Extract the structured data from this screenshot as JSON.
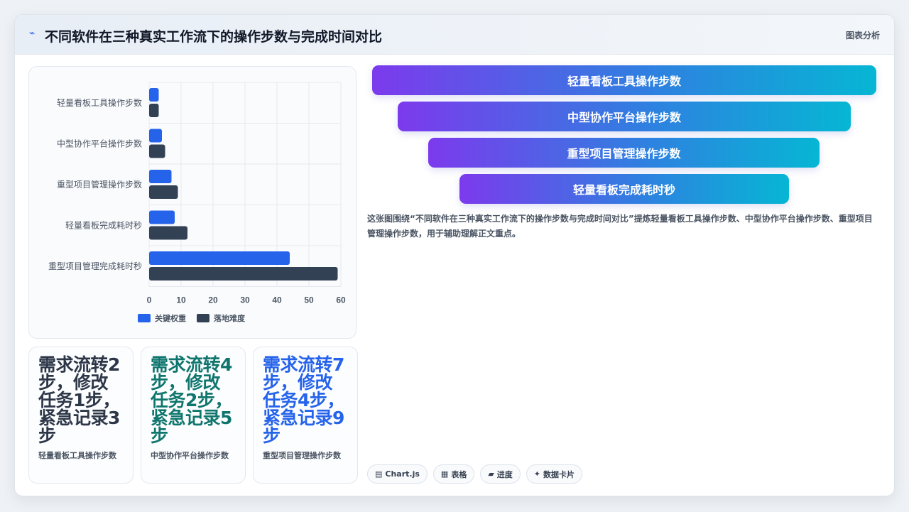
{
  "header": {
    "icon": "trend-line-icon",
    "title": "不同软件在三种真实工作流下的操作步数与完成时间对比",
    "right_label": "图表分析"
  },
  "chart_data": {
    "type": "bar",
    "orientation": "horizontal",
    "categories": [
      "轻量看板工具操作步数",
      "中型协作平台操作步数",
      "重型项目管理操作步数",
      "轻量看板完成耗时秒",
      "重型项目管理完成耗时秒"
    ],
    "series": [
      {
        "name": "关键权重",
        "values": [
          3,
          4,
          7,
          8,
          44
        ],
        "color": "#2563eb"
      },
      {
        "name": "落地难度",
        "values": [
          3,
          5,
          9,
          12,
          59
        ],
        "color": "#334155"
      }
    ],
    "xticks": [
      0,
      10,
      20,
      30,
      40,
      50,
      60
    ],
    "xlim": [
      0,
      60
    ],
    "grid": true,
    "legend_position": "bottom"
  },
  "metrics": [
    {
      "value": "需求流转2步，修改任务1步，紧急记录3步",
      "label": "轻量看板工具操作步数",
      "color": "#2d3748"
    },
    {
      "value": "需求流转4步，修改任务2步，紧急记录5步",
      "label": "中型协作平台操作步数",
      "color": "#0f766e"
    },
    {
      "value": "需求流转7步，修改任务4步，紧急记录9步",
      "label": "重型项目管理操作步数",
      "color": "#2563eb"
    }
  ],
  "funnel": [
    "轻量看板工具操作步数",
    "中型协作平台操作步数",
    "重型项目管理操作步数",
    "轻量看板完成耗时秒"
  ],
  "description": "这张图围绕“不同软件在三种真实工作流下的操作步数与完成时间对比”提炼轻量看板工具操作步数、中型协作平台操作步数、重型项目管理操作步数，用于辅助理解正文重点。",
  "tags": [
    {
      "icon": "chart-icon",
      "glyph": "▤",
      "label": "Chart.js"
    },
    {
      "icon": "table-icon",
      "glyph": "▦",
      "label": "表格"
    },
    {
      "icon": "progress-icon",
      "glyph": "▰",
      "label": "进度"
    },
    {
      "icon": "data-card-icon",
      "glyph": "✦",
      "label": "数据卡片"
    }
  ]
}
